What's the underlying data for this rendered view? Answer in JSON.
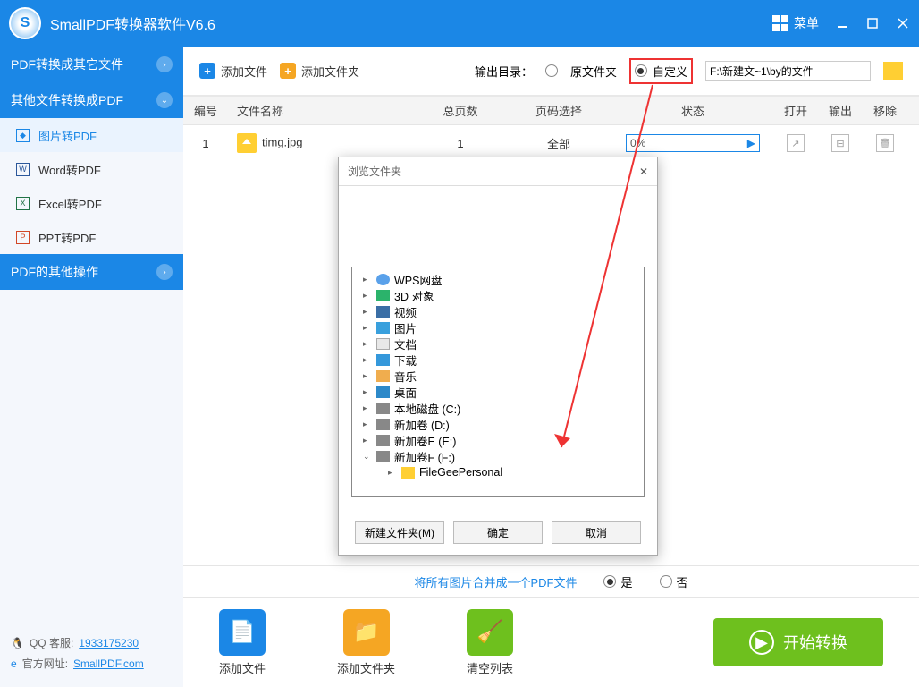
{
  "title": "SmallPDF转换器软件V6.6",
  "menu_label": "菜单",
  "sidebar": {
    "sec1": "PDF转换成其它文件",
    "sec2": "其他文件转换成PDF",
    "items": [
      {
        "label": "图片转PDF"
      },
      {
        "label": "Word转PDF"
      },
      {
        "label": "Excel转PDF"
      },
      {
        "label": "PPT转PDF"
      }
    ],
    "sec3": "PDF的其他操作"
  },
  "footer": {
    "qq_label": "QQ 客服:",
    "qq": "1933175230",
    "site_label": "官方网址:",
    "site": "SmallPDF.com"
  },
  "toolbar": {
    "add_file": "添加文件",
    "add_folder": "添加文件夹",
    "out_dir": "输出目录：",
    "orig": "原文件夹",
    "custom": "自定义",
    "path": "F:\\新建文~1\\by的文件"
  },
  "table": {
    "h_num": "编号",
    "h_name": "文件名称",
    "h_pages": "总页数",
    "h_sel": "页码选择",
    "h_status": "状态",
    "h_open": "打开",
    "h_out": "输出",
    "h_del": "移除",
    "rows": [
      {
        "num": "1",
        "name": "timg.jpg",
        "pages": "1",
        "sel": "全部",
        "status": "0%"
      }
    ]
  },
  "merge": {
    "q": "将所有图片合并成一个PDF文件",
    "yes": "是",
    "no": "否"
  },
  "bottom": {
    "add_file": "添加文件",
    "add_folder": "添加文件夹",
    "clear": "清空列表",
    "start": "开始转换"
  },
  "dialog": {
    "title": "浏览文件夹",
    "tree": [
      "WPS网盘",
      "3D 对象",
      "视频",
      "图片",
      "文档",
      "下载",
      "音乐",
      "桌面",
      "本地磁盘 (C:)",
      "新加卷 (D:)",
      "新加卷E (E:)",
      "新加卷F (F:)",
      "FileGeePersonal"
    ],
    "new_folder": "新建文件夹(M)",
    "ok": "确定",
    "cancel": "取消"
  }
}
